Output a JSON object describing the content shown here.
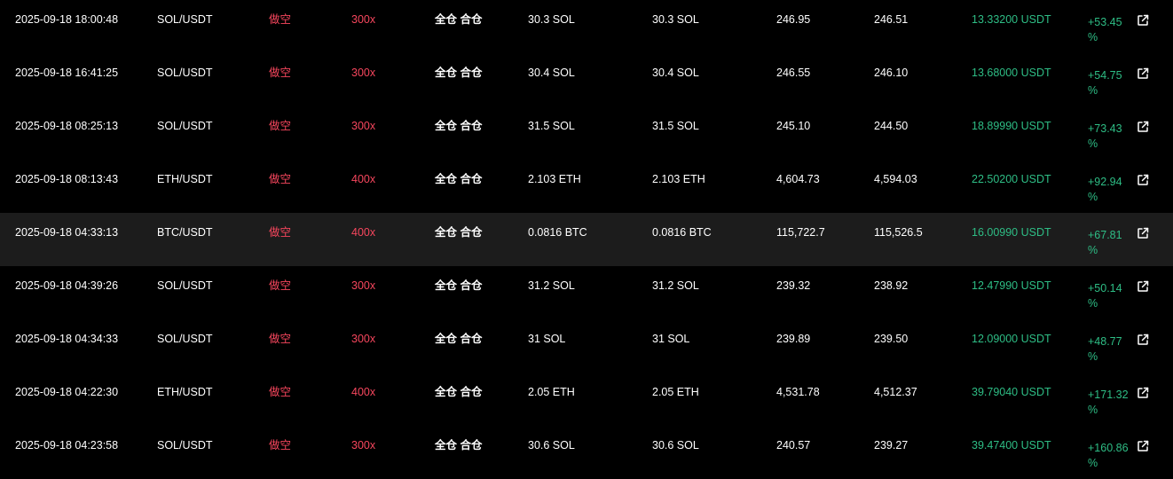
{
  "colors": {
    "background": "#000000",
    "highlight_row": "#1c1c1c",
    "short": "#f6465d",
    "profit": "#2ebd85",
    "text": "#ffffff"
  },
  "icons": {
    "share": "external-link-icon"
  },
  "rows": [
    {
      "time": "2025-09-18 18:00:48",
      "pair": "SOL/USDT",
      "side": "做空",
      "leverage": "300x",
      "margin_mode": "全仓 合仓",
      "open_size": "30.3 SOL",
      "close_size": "30.3 SOL",
      "entry_price": "246.95",
      "exit_price": "246.51",
      "pnl": "13.33200 USDT",
      "roi": "+53.45 %",
      "highlighted": false
    },
    {
      "time": "2025-09-18 16:41:25",
      "pair": "SOL/USDT",
      "side": "做空",
      "leverage": "300x",
      "margin_mode": "全仓 合仓",
      "open_size": "30.4 SOL",
      "close_size": "30.4 SOL",
      "entry_price": "246.55",
      "exit_price": "246.10",
      "pnl": "13.68000 USDT",
      "roi": "+54.75 %",
      "highlighted": false
    },
    {
      "time": "2025-09-18 08:25:13",
      "pair": "SOL/USDT",
      "side": "做空",
      "leverage": "300x",
      "margin_mode": "全仓 合仓",
      "open_size": "31.5 SOL",
      "close_size": "31.5 SOL",
      "entry_price": "245.10",
      "exit_price": "244.50",
      "pnl": "18.89990 USDT",
      "roi": "+73.43 %",
      "highlighted": false
    },
    {
      "time": "2025-09-18 08:13:43",
      "pair": "ETH/USDT",
      "side": "做空",
      "leverage": "400x",
      "margin_mode": "全仓 合仓",
      "open_size": "2.103 ETH",
      "close_size": "2.103 ETH",
      "entry_price": "4,604.73",
      "exit_price": "4,594.03",
      "pnl": "22.50200 USDT",
      "roi": "+92.94 %",
      "highlighted": false
    },
    {
      "time": "2025-09-18 04:33:13",
      "pair": "BTC/USDT",
      "side": "做空",
      "leverage": "400x",
      "margin_mode": "全仓 合仓",
      "open_size": "0.0816 BTC",
      "close_size": "0.0816 BTC",
      "entry_price": "115,722.7",
      "exit_price": "115,526.5",
      "pnl": "16.00990 USDT",
      "roi": "+67.81 %",
      "highlighted": true
    },
    {
      "time": "2025-09-18 04:39:26",
      "pair": "SOL/USDT",
      "side": "做空",
      "leverage": "300x",
      "margin_mode": "全仓 合仓",
      "open_size": "31.2 SOL",
      "close_size": "31.2 SOL",
      "entry_price": "239.32",
      "exit_price": "238.92",
      "pnl": "12.47990 USDT",
      "roi": "+50.14 %",
      "highlighted": false
    },
    {
      "time": "2025-09-18 04:34:33",
      "pair": "SOL/USDT",
      "side": "做空",
      "leverage": "300x",
      "margin_mode": "全仓 合仓",
      "open_size": "31 SOL",
      "close_size": "31 SOL",
      "entry_price": "239.89",
      "exit_price": "239.50",
      "pnl": "12.09000 USDT",
      "roi": "+48.77 %",
      "highlighted": false
    },
    {
      "time": "2025-09-18 04:22:30",
      "pair": "ETH/USDT",
      "side": "做空",
      "leverage": "400x",
      "margin_mode": "全仓 合仓",
      "open_size": "2.05 ETH",
      "close_size": "2.05 ETH",
      "entry_price": "4,531.78",
      "exit_price": "4,512.37",
      "pnl": "39.79040 USDT",
      "roi": "+171.32 %",
      "highlighted": false
    },
    {
      "time": "2025-09-18 04:23:58",
      "pair": "SOL/USDT",
      "side": "做空",
      "leverage": "300x",
      "margin_mode": "全仓 合仓",
      "open_size": "30.6 SOL",
      "close_size": "30.6 SOL",
      "entry_price": "240.57",
      "exit_price": "239.27",
      "pnl": "39.47400 USDT",
      "roi": "+160.86 %",
      "highlighted": false
    }
  ]
}
